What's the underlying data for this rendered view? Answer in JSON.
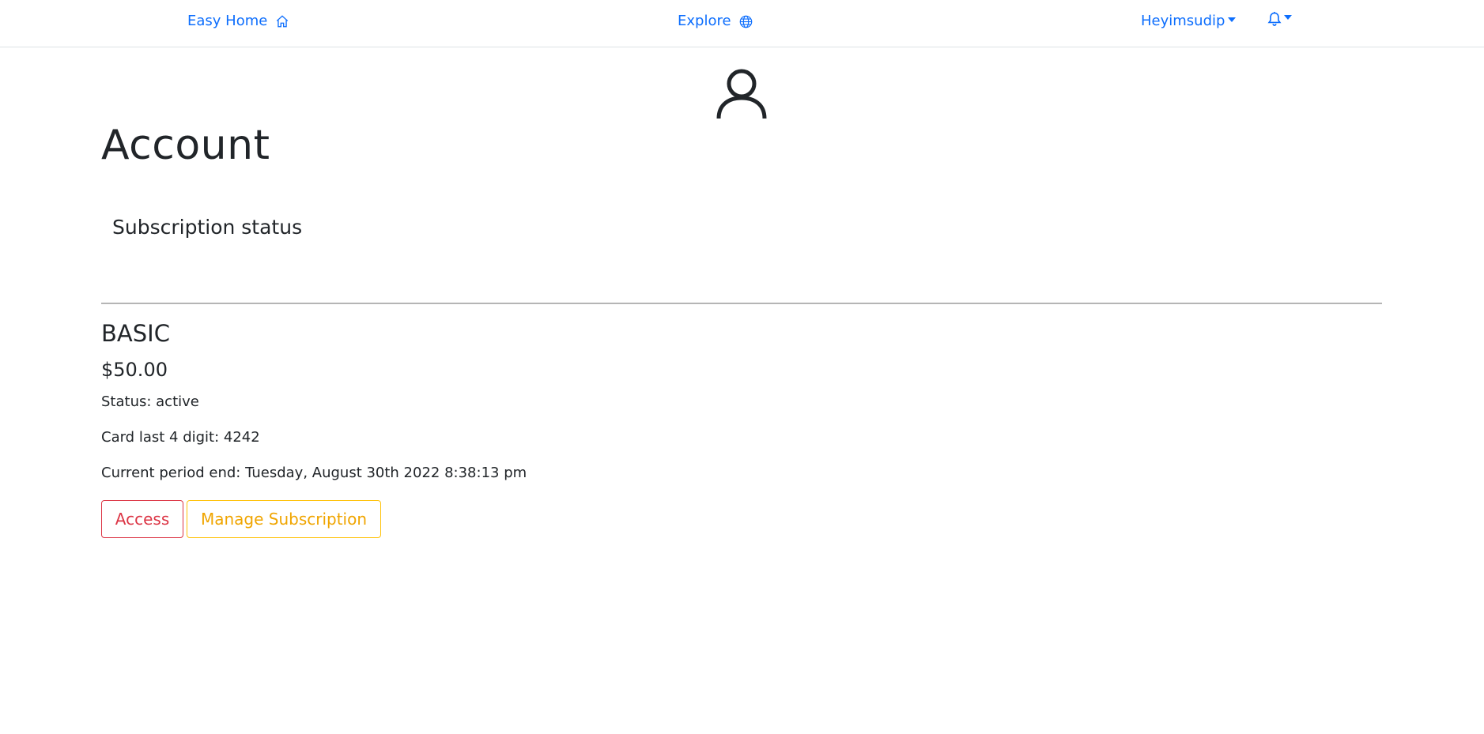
{
  "navbar": {
    "home_label": "Easy Home",
    "home_icon": "house-icon",
    "explore_label": "Explore",
    "explore_icon": "globe-icon",
    "user_label": "Heyimsudip",
    "bell_icon": "bell-icon"
  },
  "colors": {
    "link": "#0d6efd",
    "danger": "#dc3545",
    "warning": "#ffc107",
    "divider": "#b5b5b5"
  },
  "main": {
    "avatar_icon": "person-icon",
    "title": "Account",
    "section_title": "Subscription status",
    "plan": {
      "name": "BASIC",
      "price": "$50.00",
      "status": "Status: active",
      "card": "Card last 4 digit: 4242",
      "period_end": "Current period end: Tuesday, August 30th 2022 8:38:13 pm"
    },
    "buttons": {
      "access": "Access",
      "manage": "Manage Subscription"
    }
  }
}
